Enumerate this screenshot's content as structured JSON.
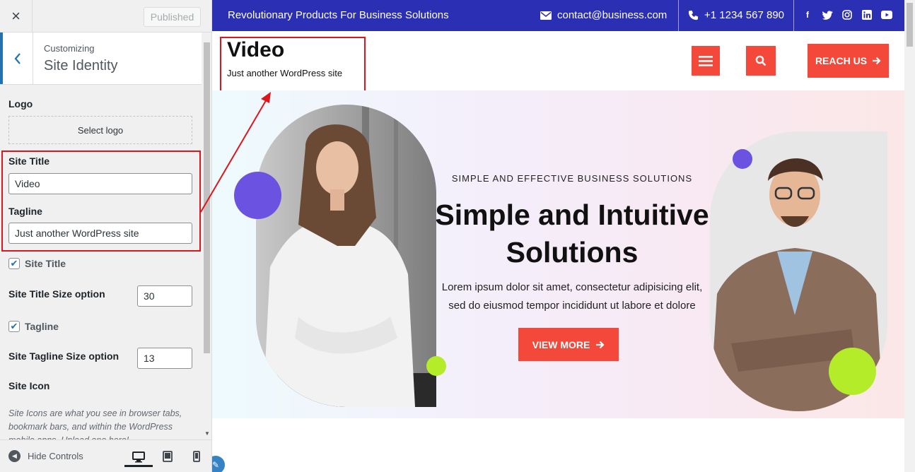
{
  "customizer": {
    "close_icon": "×",
    "publish_label": "Published",
    "breadcrumb": "Customizing",
    "section_title": "Site Identity",
    "logo_label": "Logo",
    "select_logo_label": "Select logo",
    "site_title_label": "Site Title",
    "site_title_value": "Video",
    "tagline_label": "Tagline",
    "tagline_value": "Just another WordPress site",
    "show_title_label": "Site Title",
    "show_title_checked": true,
    "title_size_label": "Site Title Size option",
    "title_size_value": "30",
    "show_tagline_label": "Tagline",
    "show_tagline_checked": true,
    "tagline_size_label": "Site Tagline Size option",
    "tagline_size_value": "13",
    "site_icon_label": "Site Icon",
    "site_icon_desc": "Site Icons are what you see in browser tabs, bookmark bars, and within the WordPress mobile apps. Upload one here!",
    "hide_controls_label": "Hide Controls",
    "devices": [
      "desktop-icon",
      "tablet-icon",
      "mobile-icon"
    ]
  },
  "preview": {
    "topbar": {
      "tagline": "Revolutionary Products For Business Solutions",
      "email": "contact@business.com",
      "phone": "+1 1234 567 890",
      "social": [
        "facebook-icon",
        "twitter-icon",
        "instagram-icon",
        "linkedin-icon",
        "youtube-icon"
      ]
    },
    "header": {
      "site_title": "Video",
      "site_tagline": "Just another WordPress site",
      "reach_label": "REACH US"
    },
    "hero": {
      "kicker": "SIMPLE AND EFFECTIVE BUSINESS SOLUTIONS",
      "title_line1": "Simple and Intuitive",
      "title_line2": "Solutions",
      "desc_line1": "Lorem ipsum dolor sit amet, consectetur adipisicing elit,",
      "desc_line2": "sed do eiusmod tempor incididunt ut labore et dolore",
      "cta_label": "VIEW MORE"
    }
  },
  "colors": {
    "topbar_bg": "#2b2fb4",
    "accent_red": "#f4483a",
    "highlight_box": "#e0151b",
    "wp_blue": "#2271b1",
    "dot_purple": "#6b52e0",
    "dot_green": "#b5ec2a"
  }
}
